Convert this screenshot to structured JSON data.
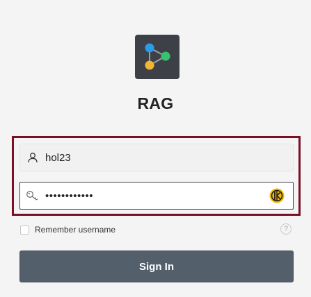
{
  "app": {
    "name": "RAG",
    "logo_icon": "network-nodes-icon",
    "logo_colors": {
      "background": "#3d4147",
      "node_blue": "#2d9ae8",
      "node_green": "#35c46b",
      "node_yellow": "#f2b632"
    }
  },
  "login": {
    "username_value": "hol23",
    "username_icon": "user-icon",
    "password_value": "••••••••••••",
    "password_icon": "key-icon",
    "password_manager_icon": "keeper-icon",
    "remember_label": "Remember username",
    "remember_checked": false,
    "help_glyph": "?",
    "signin_label": "Sign In"
  },
  "colors": {
    "highlight_border": "#7a1023",
    "button_bg": "#535f6b",
    "page_bg": "#f4f4f4"
  }
}
